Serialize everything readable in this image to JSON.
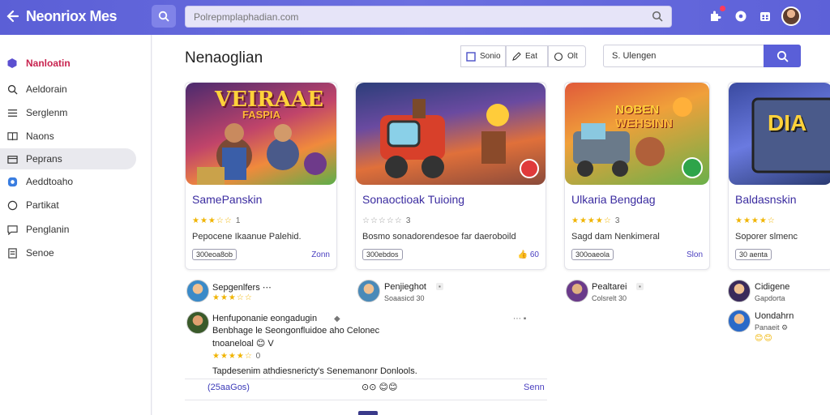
{
  "header": {
    "title": "Neonriox Mes",
    "search_placeholder": "Polrepmplaphadian.com"
  },
  "sidebar": {
    "items": [
      {
        "label": "Nanloatin",
        "icon": "hexagon-icon"
      },
      {
        "label": "Aeldorain",
        "icon": "search-icon"
      },
      {
        "label": "Serglenm",
        "icon": "list-icon"
      },
      {
        "label": "Naons",
        "icon": "book-icon"
      },
      {
        "label": "Peprans",
        "icon": "folder-icon"
      },
      {
        "label": "Aeddtoaho",
        "icon": "chat-icon"
      },
      {
        "label": "Partikat",
        "icon": "circle-icon"
      },
      {
        "label": "Penglanin",
        "icon": "message-icon"
      },
      {
        "label": "Senoe",
        "icon": "document-icon"
      }
    ]
  },
  "main": {
    "title": "Nenaoglian",
    "toolbar": [
      {
        "label": "Sonio",
        "icon": "grid-icon"
      },
      {
        "label": "Eat",
        "icon": "pencil-icon"
      },
      {
        "label": "Olt",
        "icon": "refresh-icon"
      }
    ],
    "search_value": "S. Ulengen"
  },
  "cards": [
    {
      "art_title": "VEIRAAE",
      "art_subtitle": "FASPIA",
      "title": "SamePanskin",
      "stars": "★★★☆☆",
      "count": "1",
      "desc": "Pepocene Ikaanue Palehid.",
      "tag": "300eoa8ob",
      "link": "Zonn"
    },
    {
      "art_title": "",
      "art_subtitle": "",
      "title": "Sonaoctioak Tuioing",
      "stars": "☆☆☆☆☆",
      "count": "3",
      "desc": "Bosmo sonadorendesoe far daeroboild",
      "tag": "300ebdos",
      "link": "60"
    },
    {
      "art_title": "NOBEN",
      "art_subtitle": "WEHSINN",
      "title": "Ulkaria Bengdag",
      "stars": "★★★★☆",
      "count": "3",
      "desc": "Sagd dam Nenkimeral",
      "tag": "300oaeola",
      "link": "Slon"
    },
    {
      "art_title": "DIA",
      "art_subtitle": "",
      "title": "Baldasnskin",
      "stars": "★★★★☆",
      "count": "",
      "desc": "Soporer slmenc",
      "tag": "30 aenta",
      "link": ""
    }
  ],
  "feed": [
    {
      "name": "Sepgenlfers ⋯",
      "sub": "",
      "stars": "★★★☆☆"
    },
    {
      "name": "Penjieghot",
      "sub": "Soaasicd 30",
      "stars": ""
    },
    {
      "name": "Pealtarei",
      "sub": "Colsrelt 30",
      "stars": ""
    },
    {
      "name": "Cidigene",
      "sub": "Gapdorta",
      "stars": ""
    },
    {
      "name": "Uondahrn",
      "sub": "Panaeit ⚙",
      "stars": ""
    }
  ],
  "comment": {
    "author": "Henfuponanie eongadugin",
    "line1": "Benbhage le Seongonfluidoe aho Celonec",
    "line2": "tnoaneloal 😊 V",
    "stars": "★★★★☆",
    "count": "0",
    "body": "Tapdesenim athdiesnericty's Senemanonr Donlools.",
    "tag": "(25aaGos)",
    "reactions": "⊙⊙ 😊😊",
    "link": "Senn"
  },
  "colors": {
    "accent": "#5b5fd6",
    "title_purple": "#3b2ca0",
    "star": "#f0b400"
  }
}
